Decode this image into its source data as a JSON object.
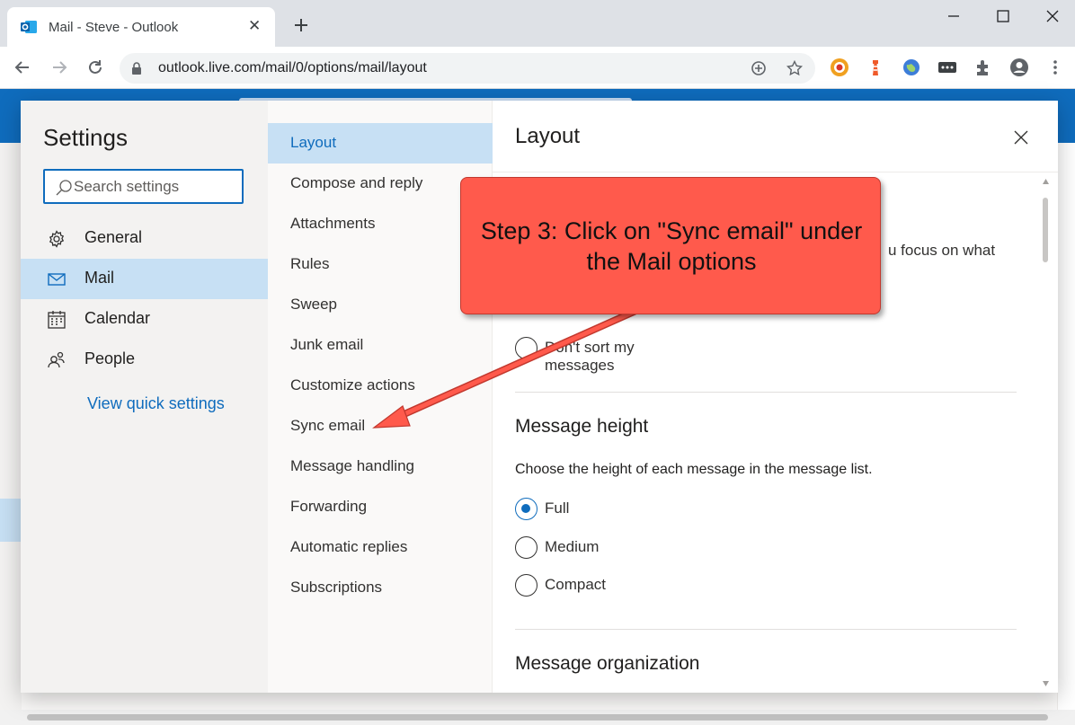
{
  "browser": {
    "tab_title": "Mail - Steve - Outlook",
    "url": "outlook.live.com/mail/0/options/mail/layout"
  },
  "settings": {
    "title": "Settings",
    "search_placeholder": "Search settings",
    "categories": [
      {
        "label": "General",
        "icon": "gear-icon"
      },
      {
        "label": "Mail",
        "icon": "mail-icon",
        "active": true
      },
      {
        "label": "Calendar",
        "icon": "calendar-icon"
      },
      {
        "label": "People",
        "icon": "people-icon"
      }
    ],
    "quick_settings_link": "View quick settings",
    "mail_options": [
      {
        "label": "Layout",
        "active": true
      },
      {
        "label": "Compose and reply"
      },
      {
        "label": "Attachments"
      },
      {
        "label": "Rules"
      },
      {
        "label": "Sweep"
      },
      {
        "label": "Junk email"
      },
      {
        "label": "Customize actions"
      },
      {
        "label": "Sync email"
      },
      {
        "label": "Message handling"
      },
      {
        "label": "Forwarding"
      },
      {
        "label": "Automatic replies"
      },
      {
        "label": "Subscriptions"
      }
    ]
  },
  "pane": {
    "title": "Layout",
    "focused_fragment": "u focus on what",
    "dont_sort_option": "Don't sort my messages",
    "message_height": {
      "heading": "Message height",
      "description": "Choose the height of each message in the message list.",
      "options": [
        "Full",
        "Medium",
        "Compact"
      ],
      "selected": "Full"
    },
    "message_organization_heading": "Message organization"
  },
  "annotation": {
    "text": "Step 3: Click on \"Sync email\" under the Mail options",
    "color": "#ff5a4c"
  },
  "colors": {
    "accent": "#0f6cbd",
    "selected_bg": "#c7e0f4"
  }
}
